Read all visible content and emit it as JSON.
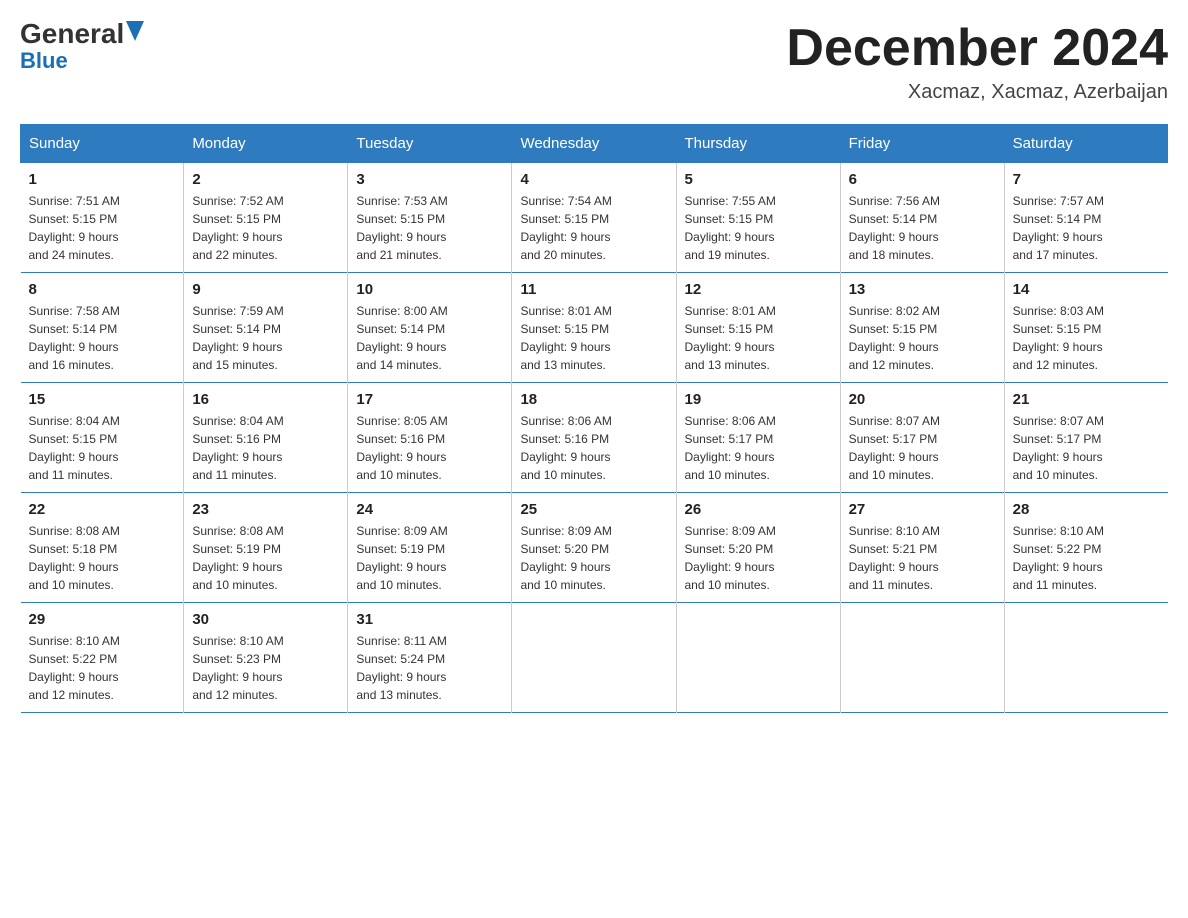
{
  "header": {
    "logo_general": "General",
    "logo_blue": "Blue",
    "month_title": "December 2024",
    "location": "Xacmaz, Xacmaz, Azerbaijan"
  },
  "days_of_week": [
    "Sunday",
    "Monday",
    "Tuesday",
    "Wednesday",
    "Thursday",
    "Friday",
    "Saturday"
  ],
  "weeks": [
    [
      {
        "day": "1",
        "sunrise": "7:51 AM",
        "sunset": "5:15 PM",
        "daylight": "9 hours and 24 minutes."
      },
      {
        "day": "2",
        "sunrise": "7:52 AM",
        "sunset": "5:15 PM",
        "daylight": "9 hours and 22 minutes."
      },
      {
        "day": "3",
        "sunrise": "7:53 AM",
        "sunset": "5:15 PM",
        "daylight": "9 hours and 21 minutes."
      },
      {
        "day": "4",
        "sunrise": "7:54 AM",
        "sunset": "5:15 PM",
        "daylight": "9 hours and 20 minutes."
      },
      {
        "day": "5",
        "sunrise": "7:55 AM",
        "sunset": "5:15 PM",
        "daylight": "9 hours and 19 minutes."
      },
      {
        "day": "6",
        "sunrise": "7:56 AM",
        "sunset": "5:14 PM",
        "daylight": "9 hours and 18 minutes."
      },
      {
        "day": "7",
        "sunrise": "7:57 AM",
        "sunset": "5:14 PM",
        "daylight": "9 hours and 17 minutes."
      }
    ],
    [
      {
        "day": "8",
        "sunrise": "7:58 AM",
        "sunset": "5:14 PM",
        "daylight": "9 hours and 16 minutes."
      },
      {
        "day": "9",
        "sunrise": "7:59 AM",
        "sunset": "5:14 PM",
        "daylight": "9 hours and 15 minutes."
      },
      {
        "day": "10",
        "sunrise": "8:00 AM",
        "sunset": "5:14 PM",
        "daylight": "9 hours and 14 minutes."
      },
      {
        "day": "11",
        "sunrise": "8:01 AM",
        "sunset": "5:15 PM",
        "daylight": "9 hours and 13 minutes."
      },
      {
        "day": "12",
        "sunrise": "8:01 AM",
        "sunset": "5:15 PM",
        "daylight": "9 hours and 13 minutes."
      },
      {
        "day": "13",
        "sunrise": "8:02 AM",
        "sunset": "5:15 PM",
        "daylight": "9 hours and 12 minutes."
      },
      {
        "day": "14",
        "sunrise": "8:03 AM",
        "sunset": "5:15 PM",
        "daylight": "9 hours and 12 minutes."
      }
    ],
    [
      {
        "day": "15",
        "sunrise": "8:04 AM",
        "sunset": "5:15 PM",
        "daylight": "9 hours and 11 minutes."
      },
      {
        "day": "16",
        "sunrise": "8:04 AM",
        "sunset": "5:16 PM",
        "daylight": "9 hours and 11 minutes."
      },
      {
        "day": "17",
        "sunrise": "8:05 AM",
        "sunset": "5:16 PM",
        "daylight": "9 hours and 10 minutes."
      },
      {
        "day": "18",
        "sunrise": "8:06 AM",
        "sunset": "5:16 PM",
        "daylight": "9 hours and 10 minutes."
      },
      {
        "day": "19",
        "sunrise": "8:06 AM",
        "sunset": "5:17 PM",
        "daylight": "9 hours and 10 minutes."
      },
      {
        "day": "20",
        "sunrise": "8:07 AM",
        "sunset": "5:17 PM",
        "daylight": "9 hours and 10 minutes."
      },
      {
        "day": "21",
        "sunrise": "8:07 AM",
        "sunset": "5:17 PM",
        "daylight": "9 hours and 10 minutes."
      }
    ],
    [
      {
        "day": "22",
        "sunrise": "8:08 AM",
        "sunset": "5:18 PM",
        "daylight": "9 hours and 10 minutes."
      },
      {
        "day": "23",
        "sunrise": "8:08 AM",
        "sunset": "5:19 PM",
        "daylight": "9 hours and 10 minutes."
      },
      {
        "day": "24",
        "sunrise": "8:09 AM",
        "sunset": "5:19 PM",
        "daylight": "9 hours and 10 minutes."
      },
      {
        "day": "25",
        "sunrise": "8:09 AM",
        "sunset": "5:20 PM",
        "daylight": "9 hours and 10 minutes."
      },
      {
        "day": "26",
        "sunrise": "8:09 AM",
        "sunset": "5:20 PM",
        "daylight": "9 hours and 10 minutes."
      },
      {
        "day": "27",
        "sunrise": "8:10 AM",
        "sunset": "5:21 PM",
        "daylight": "9 hours and 11 minutes."
      },
      {
        "day": "28",
        "sunrise": "8:10 AM",
        "sunset": "5:22 PM",
        "daylight": "9 hours and 11 minutes."
      }
    ],
    [
      {
        "day": "29",
        "sunrise": "8:10 AM",
        "sunset": "5:22 PM",
        "daylight": "9 hours and 12 minutes."
      },
      {
        "day": "30",
        "sunrise": "8:10 AM",
        "sunset": "5:23 PM",
        "daylight": "9 hours and 12 minutes."
      },
      {
        "day": "31",
        "sunrise": "8:11 AM",
        "sunset": "5:24 PM",
        "daylight": "9 hours and 13 minutes."
      },
      null,
      null,
      null,
      null
    ]
  ]
}
